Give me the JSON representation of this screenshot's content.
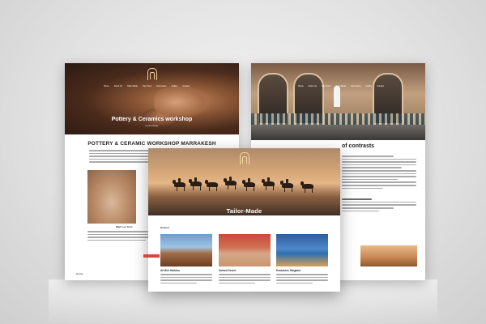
{
  "left_page": {
    "nav": [
      "Home",
      "About Us",
      "Tailor-Made",
      "Day Tours",
      "Excursions",
      "Gallery",
      "Contact"
    ],
    "hero_title": "Pottery & Ceramics workshop",
    "hero_subtitle": "by User Dearie",
    "section_title": "POTTERY & CERAMIC WORKSHOP MARRAKESH",
    "small_heading": "Want our form",
    "footer_text": "Home"
  },
  "right_page": {
    "nav": [
      "Home",
      "About Us",
      "Day Tours",
      "Tailor-Made",
      "Excursions",
      "Gallery",
      "Contact"
    ],
    "heading": "of contrasts"
  },
  "front_page": {
    "hero_title": "Tailor-Made",
    "related_label": "Related",
    "tiles": [
      {
        "title": "Ait Ben Haddou"
      },
      {
        "title": "Sahara Desert"
      },
      {
        "title": "Essaouira, Mogador"
      }
    ]
  },
  "colors": {
    "button_accent": "#cf4a3c",
    "hero_text": "#ffffff"
  }
}
